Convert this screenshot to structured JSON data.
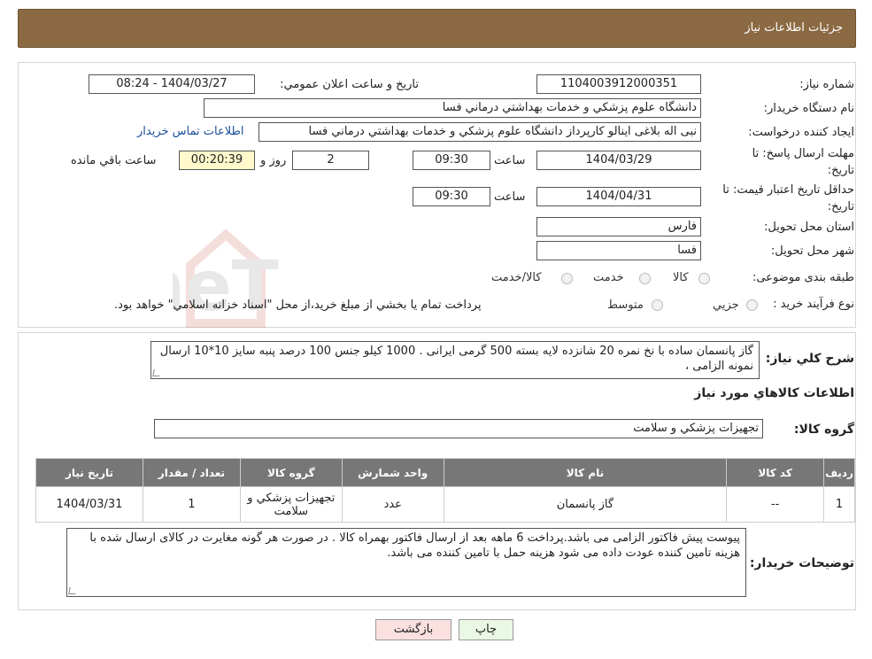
{
  "header": {
    "title": "جزئیات اطلاعات نیاز"
  },
  "form": {
    "need_number_label": "شماره نیاز:",
    "need_number": "1104003912000351",
    "announce_label": "تاریخ و ساعت اعلان عمومي:",
    "announce_value": "1404/03/27 - 08:24",
    "buyer_org_label": "نام دستگاه خريدار:",
    "buyer_org": "دانشگاه علوم پزشكي و خدمات بهداشتي درماني فسا",
    "creator_label": "ايجاد كننده درخواست:",
    "creator": "نبی اله بلاغی اینالو کارپرداز دانشگاه علوم پزشكي و خدمات بهداشتي درماني فسا",
    "contact_link": "اطلاعات تماس خريدار",
    "deadline_label_1": "مهلت ارسال پاسخ: تا",
    "deadline_label_2": "تاريخ:",
    "deadline_date": "1404/03/29",
    "time_label": "ساعت",
    "deadline_time": "09:30",
    "days_value": "2",
    "days_label": "روز و",
    "remaining_time": "00:20:39",
    "remaining_label": "ساعت باقي مانده",
    "validity_label_1": "حداقل تاريخ اعتبار قيمت: تا",
    "validity_label_2": "تاريخ:",
    "validity_date": "1404/04/31",
    "validity_time": "09:30",
    "province_label": "استان محل تحويل:",
    "province": "فارس",
    "city_label": "شهر محل تحويل:",
    "city": "فسا",
    "category_label": "طبقه بندی موضوعی:",
    "category_options": [
      "كالا",
      "خدمت",
      "كالا/خدمت"
    ],
    "process_label": "نوع فرآيند خريد :",
    "process_options": [
      "جزيي",
      "متوسط"
    ],
    "process_note": "پرداخت تمام يا بخشي از مبلغ خريد،از محل \"اسناد خزانه اسلامي\" خواهد بود."
  },
  "description": {
    "label": "شرح كلي نياز:",
    "text": "گاز پانسمان ساده با نخ نمره 20 شانزده لایه بسته 500 گرمی ایرانی . 1000 کیلو جنس 100 درصد پنبه سایز 10*10 ارسال نمونه الزامی ،"
  },
  "goods": {
    "section_title": "اطلاعات كالاهاي مورد نياز",
    "group_label": "گروه كالا:",
    "group_value": "تجهيزات پزشكي و سلامت",
    "table": {
      "headers": [
        "رديف",
        "كد كالا",
        "نام كالا",
        "واحد شمارش",
        "گروه كالا",
        "تعداد / مقدار",
        "تاريخ نياز"
      ],
      "rows": [
        [
          "1",
          "--",
          "گاز پانسمان",
          "عدد",
          "تجهيزات پزشكي و سلامت",
          "1",
          "1404/03/31"
        ]
      ]
    }
  },
  "buyer_notes": {
    "label": "توضيحات خريدار:",
    "text": "پیوست پیش فاکتور الزامی می باشد.پرداخت 6 ماهه بعد از ارسال فاکتور بهمراه کالا . در صورت هر گونه مغایرت در کالای ارسال شده با هزینه تامین کننده  عودت داده می شود  هزینه حمل با تامین  کننده می باشد."
  },
  "buttons": {
    "print": "چاپ",
    "back": "بازگشت"
  },
  "watermark": {
    "text": "AriaTender.neT"
  }
}
